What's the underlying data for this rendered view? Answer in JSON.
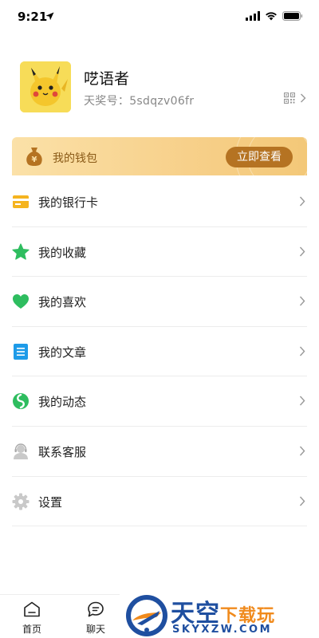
{
  "status_bar": {
    "time": "9:21"
  },
  "profile": {
    "nickname": "呓语者",
    "account_prefix": "天奖号：",
    "account_id": "5sdqzv06fr"
  },
  "wallet": {
    "label": "我的钱包",
    "button_label": "立即查看",
    "accent_color": "#b57322"
  },
  "menu": {
    "items": [
      {
        "label": "我的银行卡",
        "icon": "bank-card-icon",
        "color": "#f5b41f"
      },
      {
        "label": "我的收藏",
        "icon": "star-icon",
        "color": "#2ebd5f"
      },
      {
        "label": "我的喜欢",
        "icon": "heart-icon",
        "color": "#2ebd5f"
      },
      {
        "label": "我的文章",
        "icon": "document-icon",
        "color": "#1e9be8"
      },
      {
        "label": "我的动态",
        "icon": "moments-icon",
        "color": "#2ebd5f"
      },
      {
        "label": "联系客服",
        "icon": "customer-service-icon",
        "color": "#c9c9c9"
      },
      {
        "label": "设置",
        "icon": "gear-icon",
        "color": "#c9c9c9"
      }
    ]
  },
  "tabbar": {
    "tabs": [
      {
        "label": "首页",
        "icon": "home-icon"
      },
      {
        "label": "聊天",
        "icon": "chat-icon"
      }
    ]
  },
  "watermark": {
    "title_main": "天空",
    "title_sub": "下载玩",
    "domain": "SKYXZW.COM"
  }
}
